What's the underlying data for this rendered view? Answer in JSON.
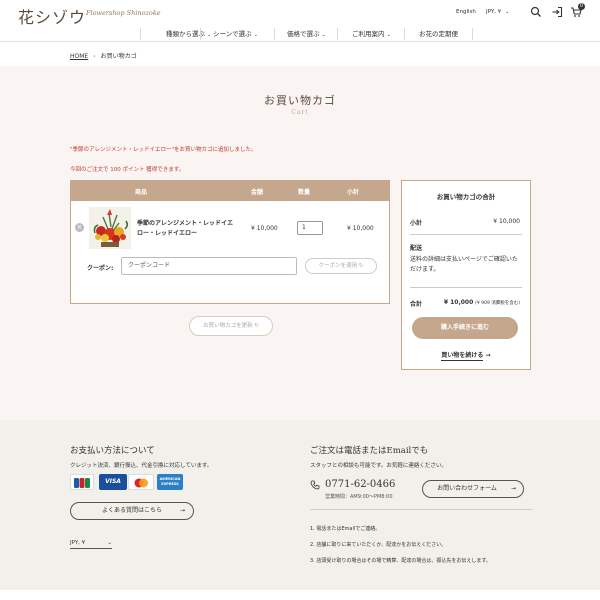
{
  "header": {
    "logo_text": "花シゾウ",
    "logo_subtitle": "Flowershop Shinozoke",
    "language": "English",
    "currency": "JPY, ¥",
    "cart_count": "0",
    "icons": [
      "search-icon",
      "login-icon",
      "cart-icon"
    ]
  },
  "nav": {
    "items": [
      {
        "label": "種類から選ぶ"
      },
      {
        "label": "シーンで選ぶ"
      },
      {
        "label": "価格で選ぶ"
      },
      {
        "label": "ご利用案内"
      },
      {
        "label": "お花の定期便"
      }
    ]
  },
  "breadcrumb": {
    "home": "HOME",
    "current": "お買い物カゴ"
  },
  "page": {
    "title": "お買い物カゴ",
    "subtitle": "Cart",
    "notice_added": "\"季節のアレンジメント・レッドイエロー\"をお買い物カゴに追加しました。",
    "notice_points": "今回のご注文で 100 ポイント 獲得できます。"
  },
  "cart": {
    "columns": [
      "商品",
      "金額",
      "数量",
      "小計"
    ],
    "items": [
      {
        "name": "季節のアレンジメント・レッドイエロー・レッドイエロー",
        "price": "¥ 10,000",
        "quantity": "1",
        "subtotal": "¥ 10,000"
      }
    ],
    "coupon_label": "クーポン:",
    "coupon_placeholder": "クーポンコード",
    "coupon_button": "クーポンを適用",
    "update_button": "お買い物カゴを更新"
  },
  "totals": {
    "title": "お買い物カゴの合計",
    "subtotal_label": "小計",
    "subtotal_value": "¥ 10,000",
    "shipping_label": "配送",
    "shipping_text": "送料の詳細は支払いページでご確認いただけます。",
    "total_label": "合計",
    "total_value": "¥ 10,000",
    "total_tax_note": "(¥ 909 消費税を含む)",
    "checkout_button": "購入手続きに進む",
    "continue_link": "買い物を続ける"
  },
  "footer": {
    "payment_title": "お支払い方法について",
    "payment_text": "クレジット決済、銀行振込、代金引換に対応しています。",
    "cards": [
      "JCB",
      "VISA",
      "MasterCard",
      "AMERICAN EXPRESS"
    ],
    "faq_button": "よくある質問はこちら",
    "currency": "JPY, ¥",
    "phone_title": "ご注文は電話またはEmailでも",
    "phone_text": "スタッフとの相談も可能です。お気軽に連絡ください。",
    "phone_number": "0771-62-0466",
    "business_hours": "営業時間：AM9:00〜PM8:00",
    "contact_button": "お問い合わせフォーム",
    "notes": [
      "1. 電話またはEmailでご連絡。",
      "2. 店舗に取りに来ていただくか、配達かをお伝えください。",
      "3. 店頭受け取りの場合はその場で精算、配達の場合は、振込先をお伝えします。"
    ]
  },
  "colors": {
    "accent": "#c4a78c",
    "notice": "#c0392b",
    "footer_bg": "#f2f0eb",
    "main_bg": "#faf5f3"
  }
}
